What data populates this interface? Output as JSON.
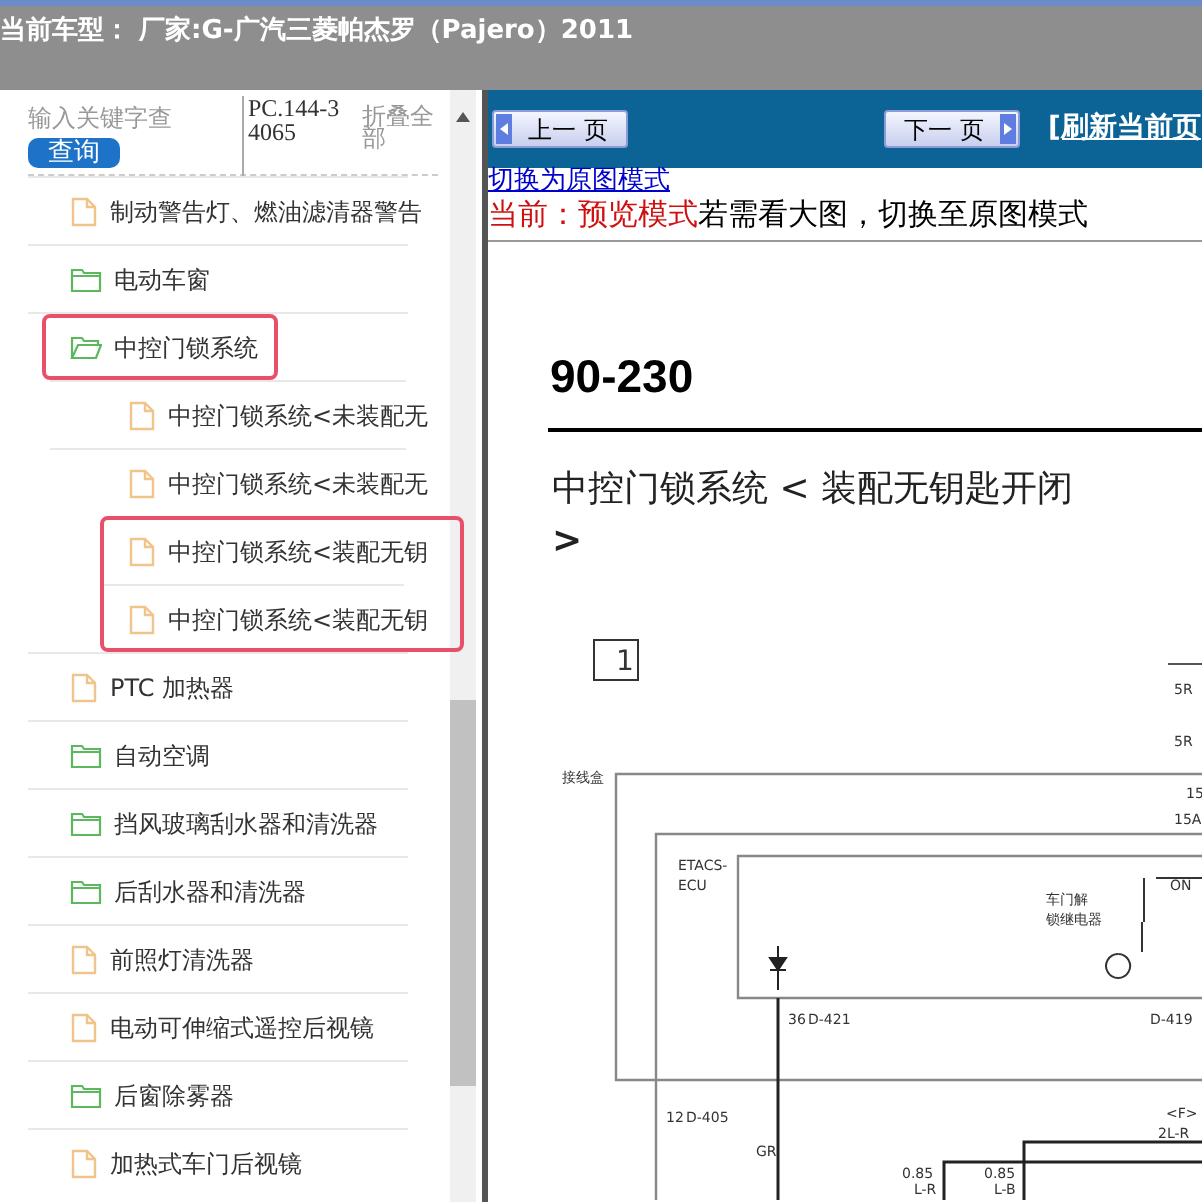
{
  "header": {
    "title": "当前车型：  厂家:G-广汽三菱帕杰罗（Pajero）2011"
  },
  "search": {
    "placeholder": "输入关键字查",
    "button": "查询",
    "code": "PC.144-34065",
    "collapse": "折叠全部"
  },
  "tree": [
    {
      "label": "制动警告灯、燃油滤清器警告",
      "kind": "file",
      "highlighted": false
    },
    {
      "label": "电动车窗",
      "kind": "folder",
      "expanded": false,
      "highlighted": false
    },
    {
      "label": "中控门锁系统",
      "kind": "folder",
      "expanded": true,
      "highlighted": true,
      "children": [
        {
          "label": "中控门锁系统<未装配无",
          "kind": "file",
          "highlighted": false
        },
        {
          "label": "中控门锁系统<未装配无",
          "kind": "file",
          "highlighted": false
        },
        {
          "label": "中控门锁系统<装配无钥",
          "kind": "file",
          "highlighted": true
        },
        {
          "label": "中控门锁系统<装配无钥",
          "kind": "file",
          "highlighted": true
        }
      ]
    },
    {
      "label": "PTC 加热器",
      "kind": "file",
      "highlighted": false
    },
    {
      "label": "自动空调",
      "kind": "folder",
      "expanded": false,
      "highlighted": false
    },
    {
      "label": "挡风玻璃刮水器和清洗器",
      "kind": "folder",
      "expanded": false,
      "highlighted": false
    },
    {
      "label": "后刮水器和清洗器",
      "kind": "folder",
      "expanded": false,
      "highlighted": false
    },
    {
      "label": "前照灯清洗器",
      "kind": "file",
      "highlighted": false
    },
    {
      "label": "电动可伸缩式遥控后视镜",
      "kind": "file",
      "highlighted": false
    },
    {
      "label": "后窗除雾器",
      "kind": "folder",
      "expanded": false,
      "highlighted": false
    },
    {
      "label": "加热式车门后视镜",
      "kind": "file",
      "highlighted": false
    }
  ],
  "toolbar": {
    "prev": "上一 页",
    "next": "下一 页",
    "refresh": "[刷新当前页"
  },
  "mode_link": "切换为原图模式",
  "mode_notice": {
    "current": "当前：预览模式",
    "hint": "若需看大图，切换至原图模式"
  },
  "document": {
    "page_number": "90-230",
    "title": "中控门锁系统 < 装配无钥匙开闭",
    "title_continued": ">",
    "diagram_labels": [
      "1",
      "5R",
      "5R",
      "接线盒",
      "15",
      "15A",
      "ETACS-",
      "ECU",
      "车门解",
      "锁继电器",
      "ON",
      "36",
      "D-421",
      "D-419",
      "12",
      "D-405",
      "<F>",
      "2L-R",
      "GR",
      "0.85",
      "L-R",
      "0.85",
      "L-B"
    ]
  }
}
